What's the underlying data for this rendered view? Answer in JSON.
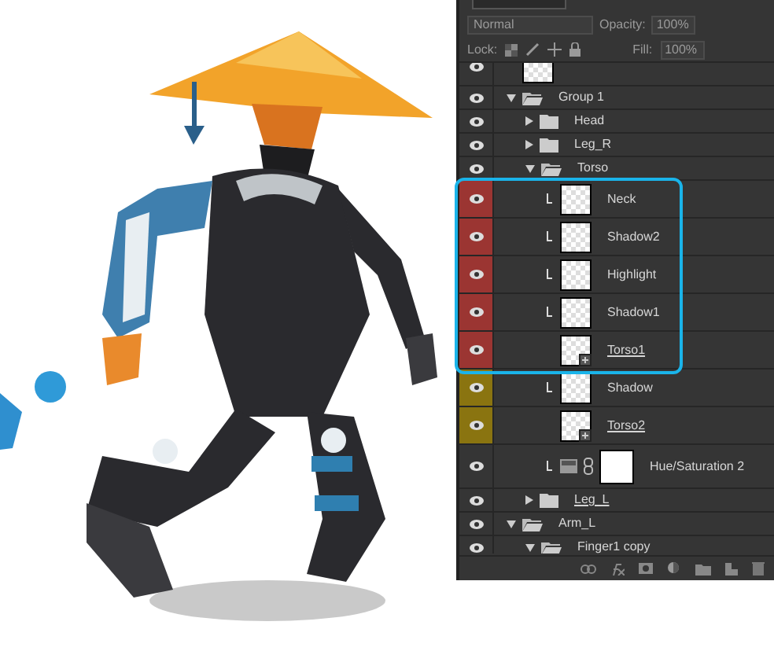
{
  "panel": {
    "blend_mode": "Normal",
    "opacity_label": "Opacity:",
    "opacity": "100%",
    "lock_label": "Lock:",
    "fill_label": "Fill:",
    "fill": "100%"
  },
  "layers": [
    {
      "kind": "layer",
      "visible": true,
      "smart_object": false
    },
    {
      "kind": "group",
      "name": "Group 1",
      "visible": true,
      "expanded": true,
      "children": [
        {
          "kind": "group",
          "name": "Head",
          "visible": true,
          "expanded": false,
          "underlined": false
        },
        {
          "kind": "group",
          "name": "Leg_R",
          "visible": true,
          "expanded": false,
          "underlined": false
        },
        {
          "kind": "group",
          "name": "Torso",
          "visible": true,
          "expanded": true,
          "children": [
            {
              "kind": "layer",
              "name": "Neck",
              "visible": true,
              "clipped": true,
              "color": "#9b3532",
              "underlined": false,
              "smart_object": false
            },
            {
              "kind": "layer",
              "name": "Shadow2",
              "visible": true,
              "clipped": true,
              "color": "#9b3532",
              "underlined": false,
              "smart_object": false
            },
            {
              "kind": "layer",
              "name": "Highlight",
              "visible": true,
              "clipped": true,
              "color": "#9b3532",
              "underlined": false,
              "smart_object": false
            },
            {
              "kind": "layer",
              "name": "Shadow1",
              "visible": true,
              "clipped": true,
              "color": "#9b3532",
              "underlined": false,
              "smart_object": false
            },
            {
              "kind": "layer",
              "name": "Torso1",
              "visible": true,
              "clipped": false,
              "color": "#9b3532",
              "underlined": true,
              "smart_object": true
            },
            {
              "kind": "layer",
              "name": "Shadow",
              "visible": true,
              "clipped": true,
              "color": "#8a7410",
              "underlined": false,
              "smart_object": false
            },
            {
              "kind": "layer",
              "name": "Torso2",
              "visible": true,
              "clipped": false,
              "color": "#8a7410",
              "underlined": true,
              "smart_object": true
            },
            {
              "kind": "adjustment",
              "name": "Hue/Saturation 2",
              "visible": true,
              "clipped": true
            }
          ]
        },
        {
          "kind": "group",
          "name": "Leg_L",
          "visible": true,
          "expanded": false,
          "underlined": true
        }
      ]
    },
    {
      "kind": "group",
      "name": "Arm_L",
      "visible": true,
      "expanded": true,
      "children": [
        {
          "kind": "group",
          "name": "Finger1 copy",
          "visible": true,
          "expanded": true
        }
      ]
    }
  ]
}
